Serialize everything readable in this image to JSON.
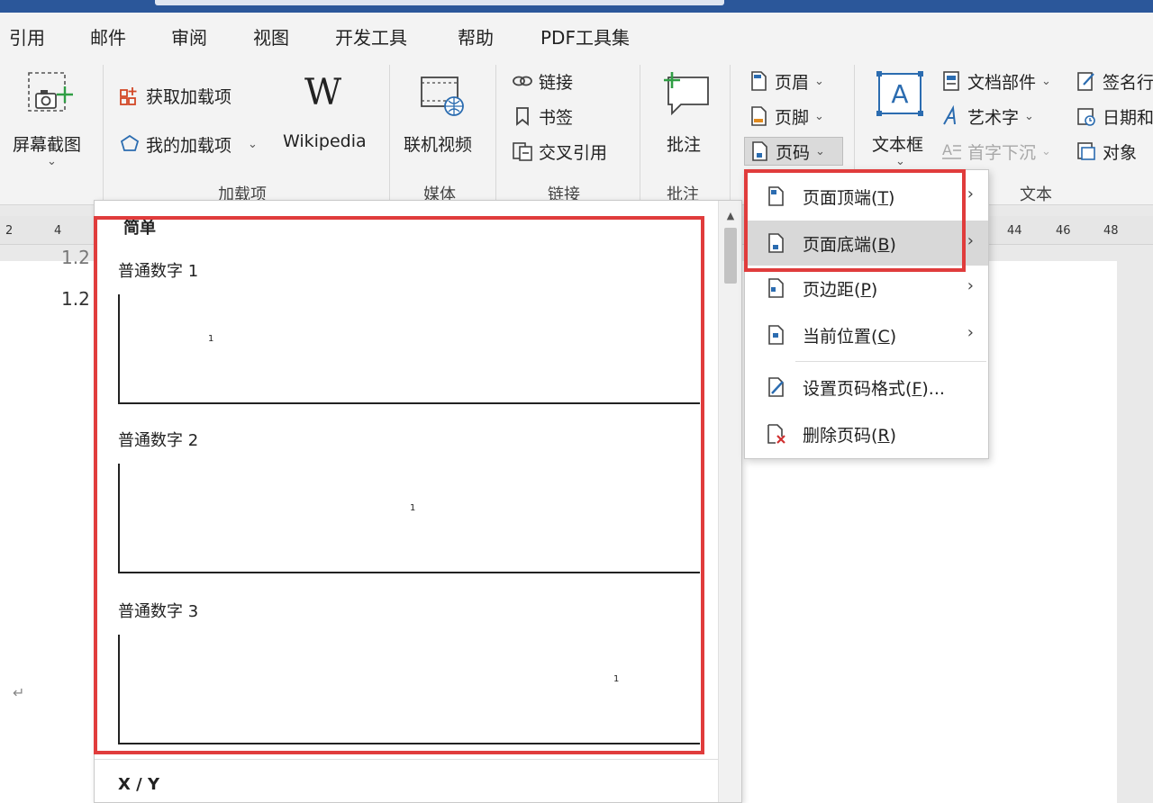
{
  "ribbon_tabs": [
    "引用",
    "邮件",
    "审阅",
    "视图",
    "开发工具",
    "帮助",
    "PDF工具集"
  ],
  "groups": {
    "screenshot": {
      "label": "屏幕截图"
    },
    "addins": {
      "label": "加载项",
      "get_addins": "获取加载项",
      "my_addins": "我的加载项",
      "wikipedia": "Wikipedia"
    },
    "media": {
      "label": "媒体",
      "online_video": "联机视频"
    },
    "links": {
      "label": "链接",
      "link": "链接",
      "bookmark": "书签",
      "cross_ref": "交叉引用"
    },
    "comments": {
      "label": "批注",
      "comment": "批注"
    },
    "header_footer": {
      "header": "页眉",
      "footer": "页脚",
      "page_number": "页码"
    },
    "text": {
      "label": "文本",
      "textbox": "文本框",
      "quick_parts": "文档部件",
      "wordart": "艺术字",
      "drop_cap": "首字下沉",
      "signature": "签名行",
      "date_time": "日期和",
      "object": "对象"
    }
  },
  "ruler_left": [
    "2",
    "4"
  ],
  "ruler_right": [
    "44",
    "46",
    "48"
  ],
  "document": {
    "line1": "1.2",
    "line0": "1.2",
    "return_mark": "↵"
  },
  "gallery": {
    "section": "简单",
    "items": [
      {
        "label": "普通数字 1",
        "num": "1"
      },
      {
        "label": "普通数字 2",
        "num": "1"
      },
      {
        "label": "普通数字 3",
        "num": "1"
      }
    ],
    "next_section": "X / Y"
  },
  "menu": {
    "top": {
      "label": "页面顶端",
      "key": "T"
    },
    "bottom": {
      "label": "页面底端",
      "key": "B"
    },
    "margin": {
      "label": "页边距",
      "key": "P"
    },
    "current": {
      "label": "当前位置",
      "key": "C"
    },
    "format": {
      "label": "设置页码格式",
      "key": "F",
      "suffix": "..."
    },
    "remove": {
      "label": "删除页码",
      "key": "R"
    }
  },
  "colors": {
    "accent": "#2b579a",
    "highlight": "#e03c3c",
    "addin_orange": "#d24726"
  }
}
